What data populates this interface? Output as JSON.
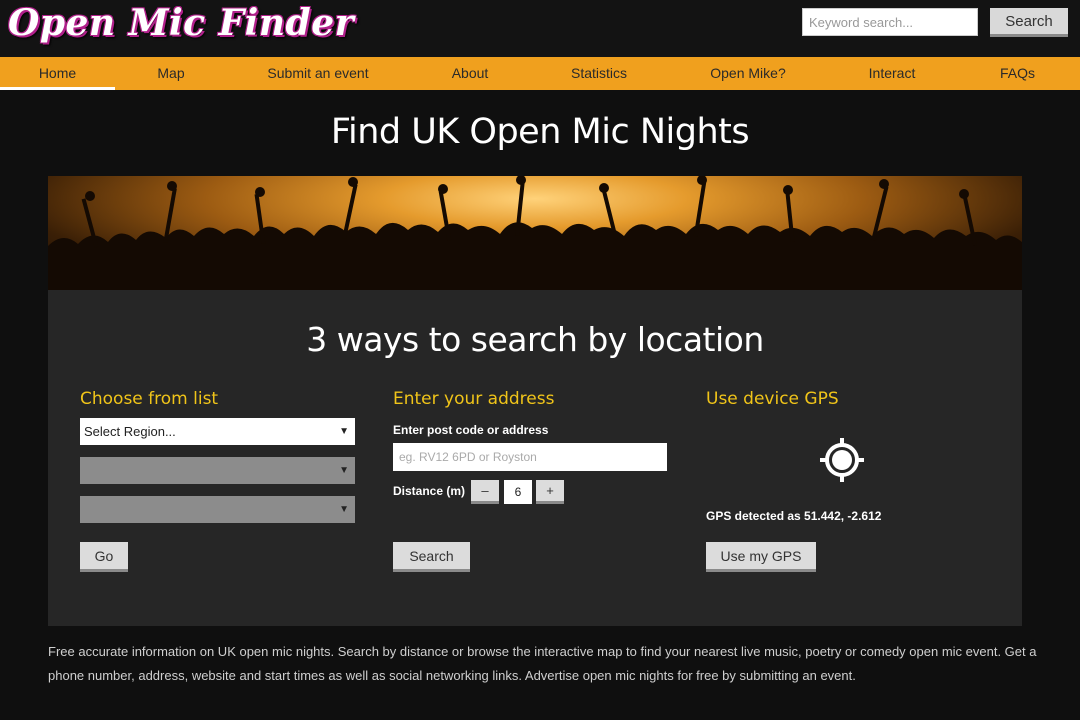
{
  "header": {
    "logo": "Open Mic Finder",
    "search_placeholder": "Keyword search...",
    "search_button": "Search"
  },
  "nav": {
    "items": [
      {
        "label": "Home",
        "active": true
      },
      {
        "label": "Map"
      },
      {
        "label": "Submit an event"
      },
      {
        "label": "About"
      },
      {
        "label": "Statistics"
      },
      {
        "label": "Open Mike?"
      },
      {
        "label": "Interact"
      },
      {
        "label": "FAQs"
      }
    ]
  },
  "page_title": "Find UK Open Mic Nights",
  "panel": {
    "title": "3 ways to search by location",
    "list": {
      "title": "Choose from list",
      "region_select": "Select Region...",
      "go_button": "Go"
    },
    "address": {
      "title": "Enter your address",
      "label": "Enter post code or address",
      "placeholder": "eg. RV12 6PD or Royston",
      "distance_label": "Distance (m)",
      "minus": "–",
      "plus": "+",
      "distance_value": "6",
      "search_button": "Search"
    },
    "gps": {
      "title": "Use device GPS",
      "detected": "GPS detected as 51.442, -2.612",
      "button": "Use my GPS"
    }
  },
  "description": "Free accurate information on UK open mic nights. Search by distance or browse the interactive map to find your nearest live music, poetry or comedy open mic event. Get a phone number, address, website and start times as well as social networking links. Advertise open mic nights for free by submitting an event.",
  "colors": {
    "nav_bg": "#f0a01e",
    "heading_accent": "#f0c419",
    "logo_outline": "#b0208a"
  }
}
